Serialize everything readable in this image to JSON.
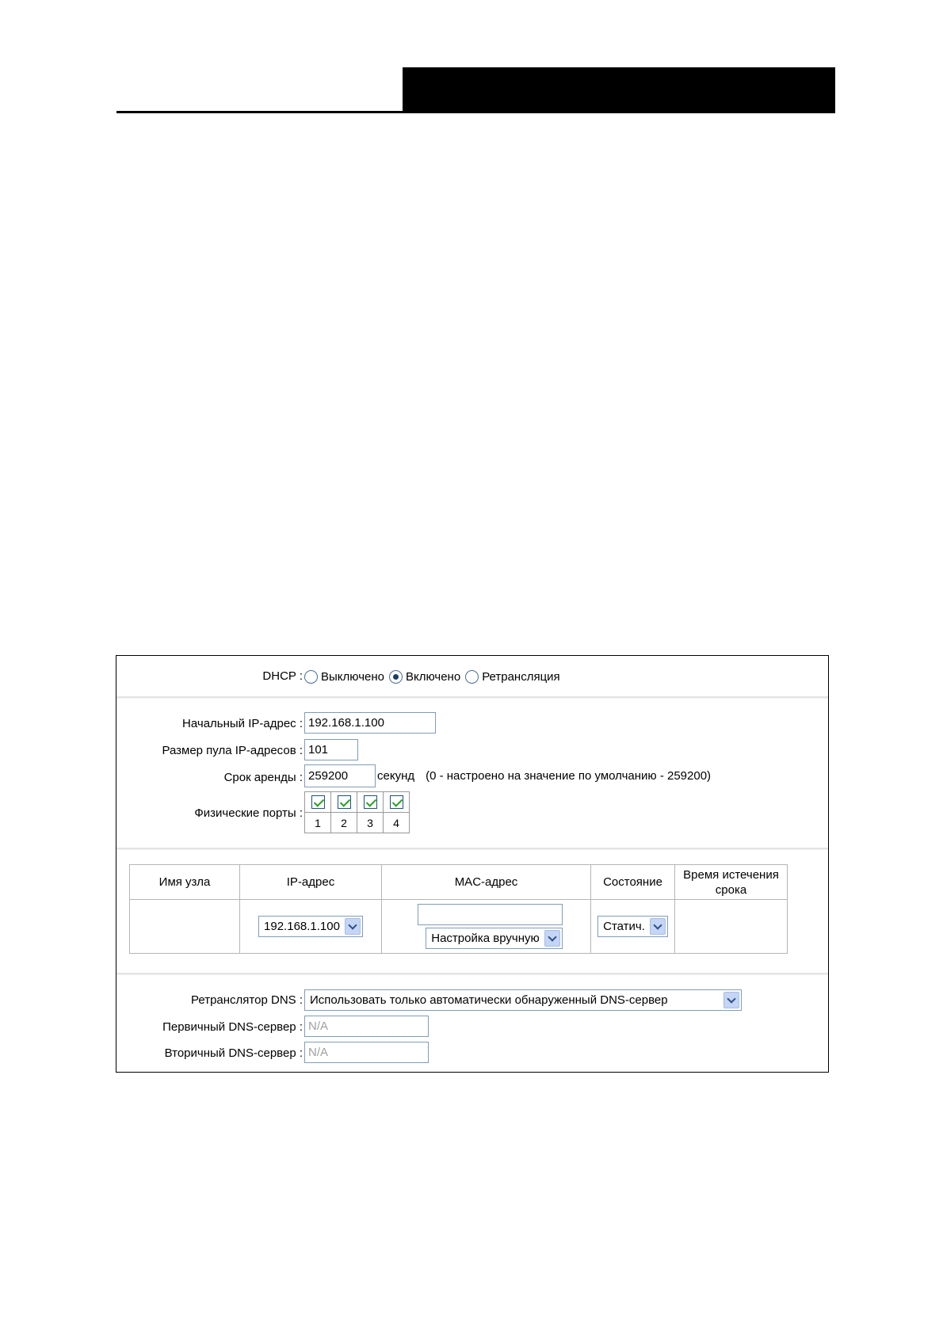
{
  "dhcp": {
    "label": "DHCP :",
    "options": [
      {
        "label": "Выключено",
        "selected": false
      },
      {
        "label": "Включено",
        "selected": true
      },
      {
        "label": "Ретрансляция",
        "selected": false
      }
    ]
  },
  "pool": {
    "start_ip": {
      "label": "Начальный IP-адрес :",
      "value": "192.168.1.100"
    },
    "pool_size": {
      "label": "Размер пула IP-адресов :",
      "value": "101"
    },
    "lease": {
      "label": "Срок аренды :",
      "value": "259200",
      "unit": "секунд",
      "hint": "(0 - настроено на значение по умолчанию - 259200)"
    },
    "ports": {
      "label": "Физические порты :",
      "items": [
        "1",
        "2",
        "3",
        "4"
      ]
    }
  },
  "binding": {
    "headers": {
      "host": "Имя узла",
      "ip": "IP-адрес",
      "mac": "MAC-адрес",
      "state": "Состояние",
      "expire": "Время истечения срока"
    },
    "ip_value": "192.168.1.100",
    "mac_value": "",
    "mac_mode": "Настройка вручную",
    "state_value": "Статич."
  },
  "dns": {
    "relay": {
      "label": "Ретранслятор DNS :",
      "value": "Использовать только автоматически обнаруженный DNS-сервер"
    },
    "primary": {
      "label": "Первичный DNS-сервер :",
      "value": "N/A"
    },
    "secondary": {
      "label": "Вторичный DNS-сервер :",
      "value": "N/A"
    }
  }
}
